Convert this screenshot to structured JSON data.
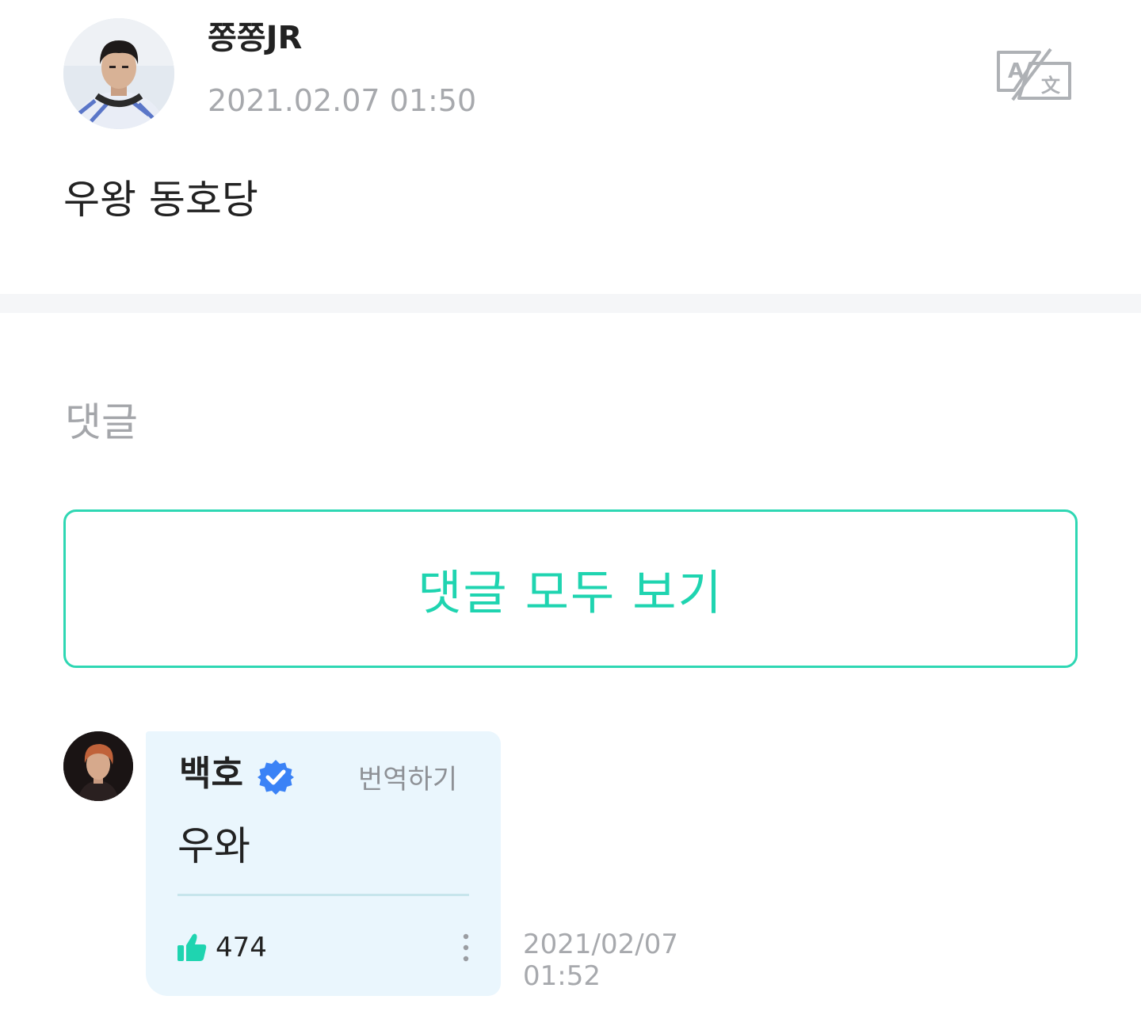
{
  "post": {
    "author": "쫑쫑JR",
    "timestamp": "2021.02.07 01:50",
    "body": "우왕 동호당",
    "avatar_icon": "user-photo-avatar",
    "translate_icon": "translate-icon"
  },
  "comments": {
    "heading": "댓글",
    "view_all_label": "댓글 모두 보기",
    "items": [
      {
        "author": "백호",
        "verified": true,
        "translate_label": "번역하기",
        "text": "우와",
        "likes": "474",
        "date": "2021/02/07",
        "time": "01:52"
      }
    ]
  },
  "colors": {
    "accent": "#1fd4b0",
    "bubble_bg": "#eaf6fd",
    "verified": "#3b82f6",
    "muted_text": "#a7a9ad"
  }
}
